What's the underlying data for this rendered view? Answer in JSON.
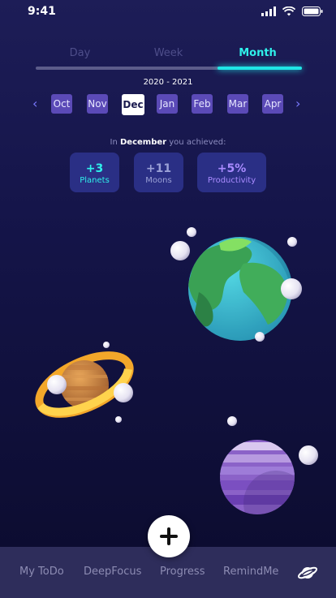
{
  "status_bar": {
    "time": "9:41",
    "icons": [
      "signal-icon",
      "wifi-icon",
      "battery-icon"
    ]
  },
  "segments": {
    "tabs": [
      "Day",
      "Week",
      "Month"
    ],
    "active": "Month"
  },
  "year_range": "2020 - 2021",
  "months": {
    "items": [
      "Oct",
      "Nov",
      "Dec",
      "Jan",
      "Feb",
      "Mar",
      "Apr"
    ],
    "selected": "Dec"
  },
  "achievement": {
    "prefix": "In",
    "month": "December",
    "suffix": "you achieved:"
  },
  "stats": [
    {
      "value": "+3",
      "label": "Planets",
      "color": "#2ff0ea"
    },
    {
      "value": "+11",
      "label": "Moons",
      "color": "#9aa0d6"
    },
    {
      "value": "+5%",
      "label": "Productivity",
      "color": "#a98bff"
    }
  ],
  "fab_icon": "plus-icon",
  "bottom_nav": {
    "items": [
      "My ToDo",
      "DeepFocus",
      "Progress",
      "RemindMe"
    ],
    "icon": "planet-icon"
  },
  "colors": {
    "accent": "#20e6e6",
    "month_bg": "#5b4ab7",
    "stat_bg": "#2a2f85",
    "nav_bg": "#2e2d5b"
  }
}
